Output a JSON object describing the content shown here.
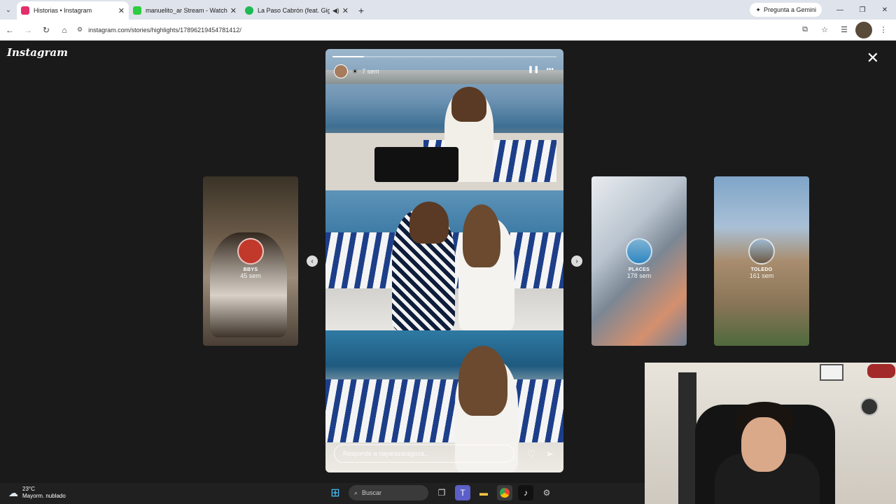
{
  "browser": {
    "tabs": [
      {
        "title": "Historias • Instagram",
        "active": true,
        "favicon_color": "#e1306c"
      },
      {
        "title": "manuelito_ar Stream - Watch Li",
        "active": false,
        "favicon_color": "#2ecc40"
      },
      {
        "title": "La Paso Cabrón (feat. Gigoli",
        "active": false,
        "favicon_color": "#1db954"
      }
    ],
    "gemini_label": "Pregunta a Gemini",
    "url": "instagram.com/stories/highlights/17896219454781412/"
  },
  "instagram": {
    "logo": "Instagram",
    "story": {
      "time": "7 sem",
      "progress": 0.14,
      "reply_placeholder": "Responde a nayarazaragoza..."
    },
    "highlights": [
      {
        "name": "BBYS",
        "time": "45 sem"
      },
      {
        "name": "PLACES",
        "time": "178 sem"
      },
      {
        "name": "TOLEDO",
        "time": "161 sem"
      }
    ]
  },
  "taskbar": {
    "temperature": "23°C",
    "weather": "Mayorm. nublado",
    "search_label": "Buscar"
  }
}
